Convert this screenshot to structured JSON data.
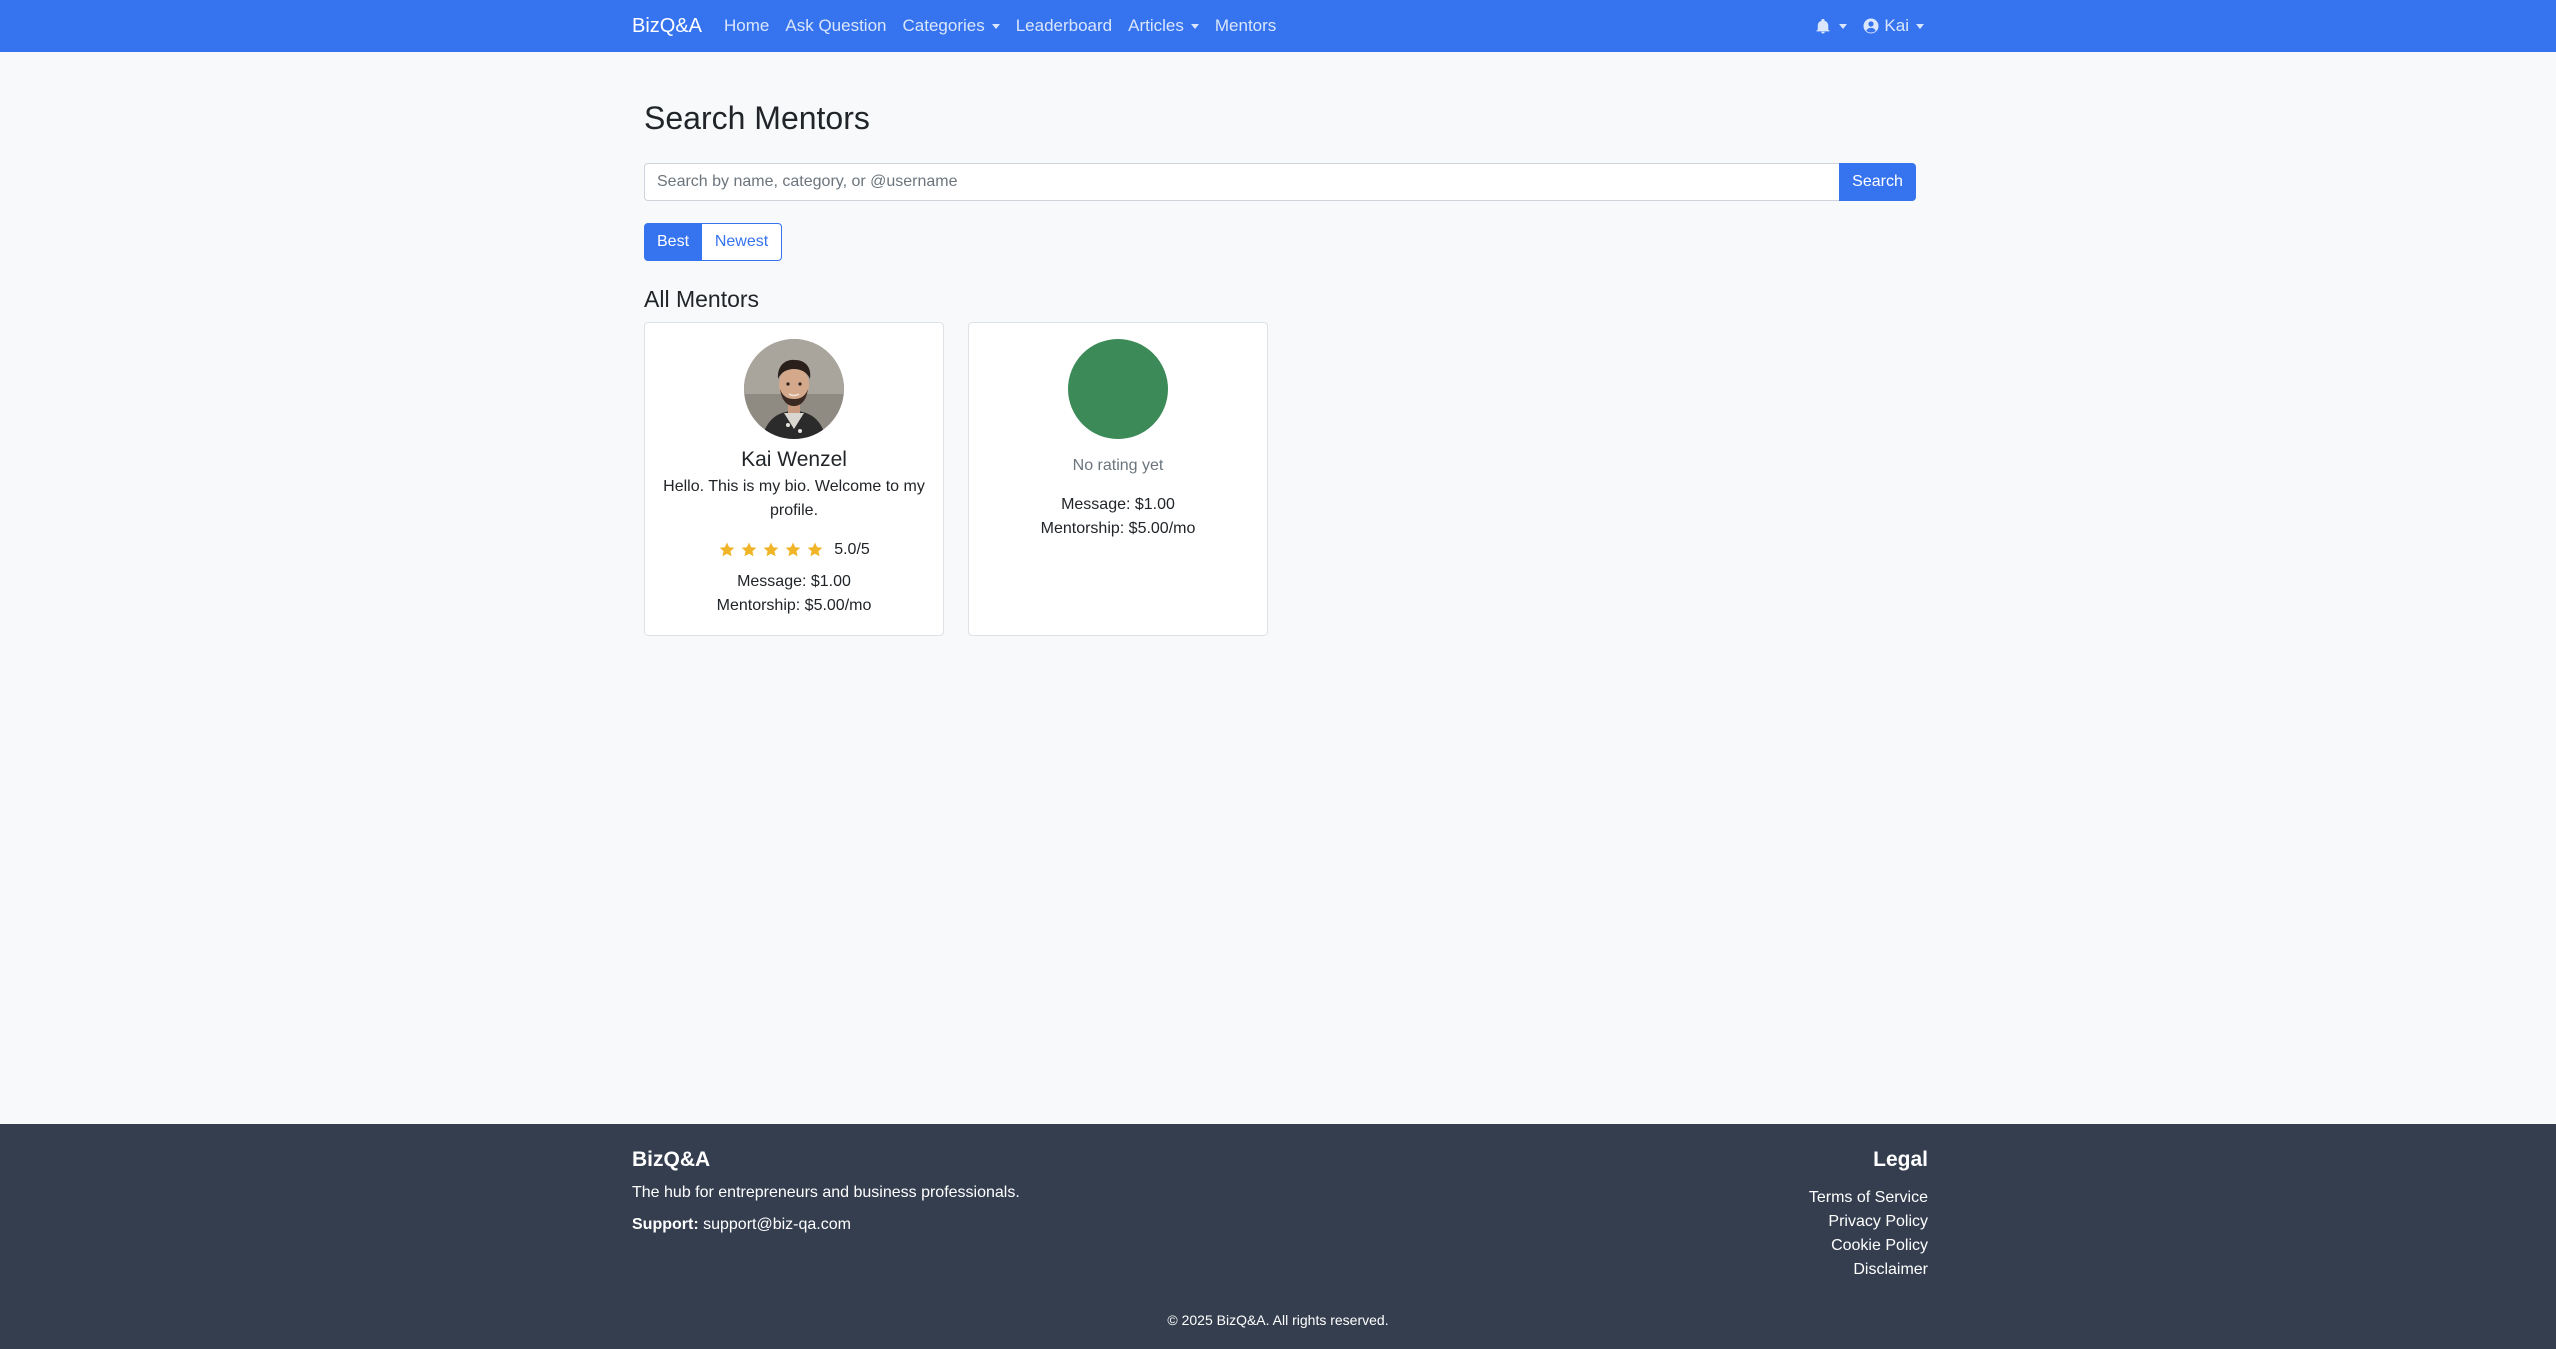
{
  "navbar": {
    "brand": "BizQ&A",
    "links": [
      {
        "label": "Home"
      },
      {
        "label": "Ask Question"
      },
      {
        "label": "Categories"
      },
      {
        "label": "Leaderboard"
      },
      {
        "label": "Articles"
      },
      {
        "label": "Mentors"
      }
    ],
    "notifications_icon": "bell-icon",
    "user": {
      "icon": "user-circle-icon",
      "label": "Kai"
    },
    "color": "#3573ef"
  },
  "main": {
    "title": "Search Mentors",
    "search": {
      "placeholder": "Search by name, category, or @username",
      "value": "",
      "button_label": "Search"
    },
    "sort": [
      {
        "label": "Best",
        "active": true
      },
      {
        "label": "Newest",
        "active": false
      }
    ],
    "section_title": "All Mentors",
    "mentors": [
      {
        "name": "Kai Wenzel",
        "bio": "Hello. This is my bio. Welcome to my profile.",
        "rating_text": "5.0/5",
        "stars": 5,
        "message_price": "Message: $1.00",
        "mentorship_price": "Mentorship: $5.00/mo",
        "avatar": "photo"
      },
      {
        "name": "",
        "rating_text": "No rating yet",
        "message_price": "Message: $1.00",
        "mentorship_price": "Mentorship: $5.00/mo",
        "avatar_color": "#3b8a58"
      }
    ]
  },
  "footer": {
    "brand": "BizQ&A",
    "tagline": "The hub for entrepreneurs and business professionals.",
    "support_label": "Support:",
    "support_email": "support@biz-qa.com",
    "legal_title": "Legal",
    "legal_links": [
      "Terms of Service",
      "Privacy Policy",
      "Cookie Policy",
      "Disclaimer"
    ],
    "copyright": "© 2025 BizQ&A. All rights reserved.",
    "background": "#343e4f"
  },
  "colors": {
    "accent": "#3573ef",
    "star": "#f0b429",
    "page_bg": "#f8f9fa"
  }
}
